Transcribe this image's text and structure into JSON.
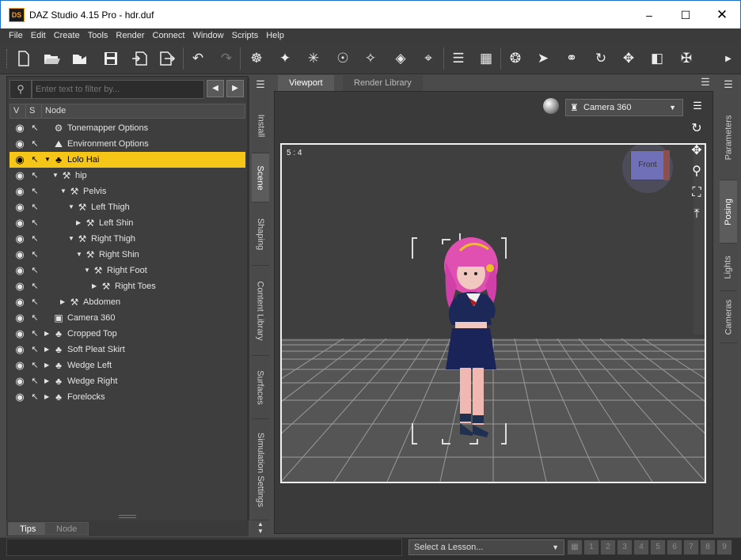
{
  "window": {
    "app_icon": "DS",
    "title": "DAZ Studio 4.15 Pro - hdr.duf",
    "controls": [
      "minimize-icon",
      "maximize-icon",
      "close-icon"
    ]
  },
  "menu": [
    "File",
    "Edit",
    "Create",
    "Tools",
    "Render",
    "Connect",
    "Window",
    "Scripts",
    "Help"
  ],
  "toolbar_icons": [
    "new-file-icon",
    "open-file-icon",
    "merge-file-icon",
    "save-icon",
    "import-icon",
    "export-icon",
    "undo-icon",
    "redo-icon",
    "scene-tool-icon",
    "universal-tool-icon",
    "active-pose-icon",
    "rotate-tool-icon",
    "pose-tool-icon",
    "node-weight-icon",
    "joint-editor-icon",
    "align-icon",
    "grid-icon",
    "camera-orbit-icon",
    "pointer-icon",
    "spot-render-icon",
    "spin-icon",
    "translate-icon",
    "scale-icon",
    "joint-tool-icon"
  ],
  "scene_pane": {
    "filter_placeholder": "Enter text to filter by...",
    "columns": {
      "visible": "V",
      "selectable": "S",
      "node": "Node"
    },
    "nodes": [
      {
        "label": "Tonemapper Options",
        "icon": "settings-icon",
        "depth": 0,
        "expand": "",
        "selected": false
      },
      {
        "label": "Environment Options",
        "icon": "environment-icon",
        "depth": 0,
        "expand": "",
        "selected": false
      },
      {
        "label": "Lolo Hai",
        "icon": "figure-icon",
        "depth": 0,
        "expand": "open",
        "selected": true
      },
      {
        "label": "hip",
        "icon": "bone-icon",
        "depth": 1,
        "expand": "open",
        "selected": false
      },
      {
        "label": "Pelvis",
        "icon": "bone-icon",
        "depth": 2,
        "expand": "open",
        "selected": false
      },
      {
        "label": "Left Thigh",
        "icon": "bone-icon",
        "depth": 3,
        "expand": "open",
        "selected": false
      },
      {
        "label": "Left Shin",
        "icon": "bone-icon",
        "depth": 4,
        "expand": "closed",
        "selected": false
      },
      {
        "label": "Right Thigh",
        "icon": "bone-icon",
        "depth": 3,
        "expand": "open",
        "selected": false
      },
      {
        "label": "Right Shin",
        "icon": "bone-icon",
        "depth": 4,
        "expand": "open",
        "selected": false
      },
      {
        "label": "Right Foot",
        "icon": "bone-icon",
        "depth": 5,
        "expand": "open",
        "selected": false
      },
      {
        "label": "Right Toes",
        "icon": "bone-icon",
        "depth": 6,
        "expand": "closed",
        "selected": false
      },
      {
        "label": "Abdomen",
        "icon": "bone-icon",
        "depth": 2,
        "expand": "closed",
        "selected": false
      },
      {
        "label": "Camera 360",
        "icon": "camera-icon",
        "depth": 0,
        "expand": "",
        "selected": false
      },
      {
        "label": "Cropped Top",
        "icon": "figure-icon",
        "depth": 0,
        "expand": "closed",
        "selected": false
      },
      {
        "label": "Soft Pleat Skirt",
        "icon": "figure-icon",
        "depth": 0,
        "expand": "closed",
        "selected": false
      },
      {
        "label": "Wedge Left",
        "icon": "figure-icon",
        "depth": 0,
        "expand": "closed",
        "selected": false
      },
      {
        "label": "Wedge Right",
        "icon": "figure-icon",
        "depth": 0,
        "expand": "closed",
        "selected": false
      },
      {
        "label": "Forelocks",
        "icon": "figure-icon",
        "depth": 0,
        "expand": "closed",
        "selected": false
      }
    ],
    "bottom_tabs": [
      "Tips",
      "Node"
    ]
  },
  "left_side_tabs": [
    "Install",
    "Scene",
    "Shaping",
    "Content Library",
    "Surfaces",
    "Simulation Settings"
  ],
  "active_left_tab": "Scene",
  "right_side_tabs": [
    "Parameters",
    "Posing",
    "Lights",
    "Cameras"
  ],
  "active_right_tab": "Posing",
  "viewport": {
    "tabs": [
      "Viewport",
      "Render Library"
    ],
    "active_tab": "Viewport",
    "camera": "Camera 360",
    "aspect_ratio": "5 : 4",
    "view_cube_label": "Front"
  },
  "status": {
    "lesson_placeholder": "Select a Lesson...",
    "lesson_steps": [
      "1",
      "2",
      "3",
      "4",
      "5",
      "6",
      "7",
      "8",
      "9"
    ]
  },
  "colors": {
    "selection": "#f5c518",
    "titlebar_border": "#1a6fc9"
  }
}
